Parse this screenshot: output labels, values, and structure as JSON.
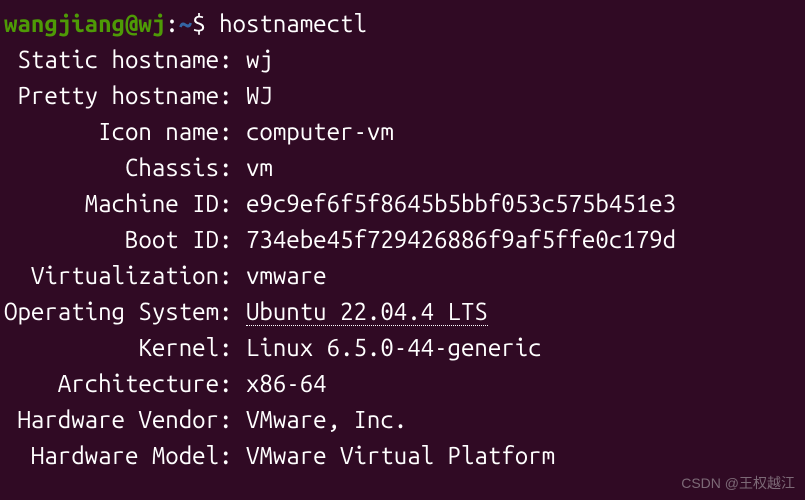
{
  "prompt": {
    "user_host": "wangjiang@wj",
    "colon": ":",
    "path": "~",
    "dollar": "$ ",
    "command": "hostnamectl"
  },
  "output": {
    "static_hostname": {
      "label": " Static hostname:",
      "value": "wj"
    },
    "pretty_hostname": {
      "label": " Pretty hostname:",
      "value": "WJ"
    },
    "icon_name": {
      "label": "       Icon name:",
      "value": "computer-vm"
    },
    "chassis": {
      "label": "         Chassis:",
      "value": "vm"
    },
    "machine_id": {
      "label": "      Machine ID:",
      "value": "e9c9ef6f5f8645b5bbf053c575b451e3"
    },
    "boot_id": {
      "label": "         Boot ID:",
      "value": "734ebe45f729426886f9af5ffe0c179d"
    },
    "virtualization": {
      "label": "  Virtualization:",
      "value": "vmware"
    },
    "operating_system": {
      "label": "Operating System:",
      "value": "Ubuntu 22.04.4 LTS"
    },
    "kernel": {
      "label": "          Kernel:",
      "value": "Linux 6.5.0-44-generic"
    },
    "architecture": {
      "label": "    Architecture:",
      "value": "x86-64"
    },
    "hardware_vendor": {
      "label": " Hardware Vendor:",
      "value": "VMware, Inc."
    },
    "hardware_model": {
      "label": "  Hardware Model:",
      "value": "VMware Virtual Platform"
    }
  },
  "watermark": "CSDN @王权越江"
}
